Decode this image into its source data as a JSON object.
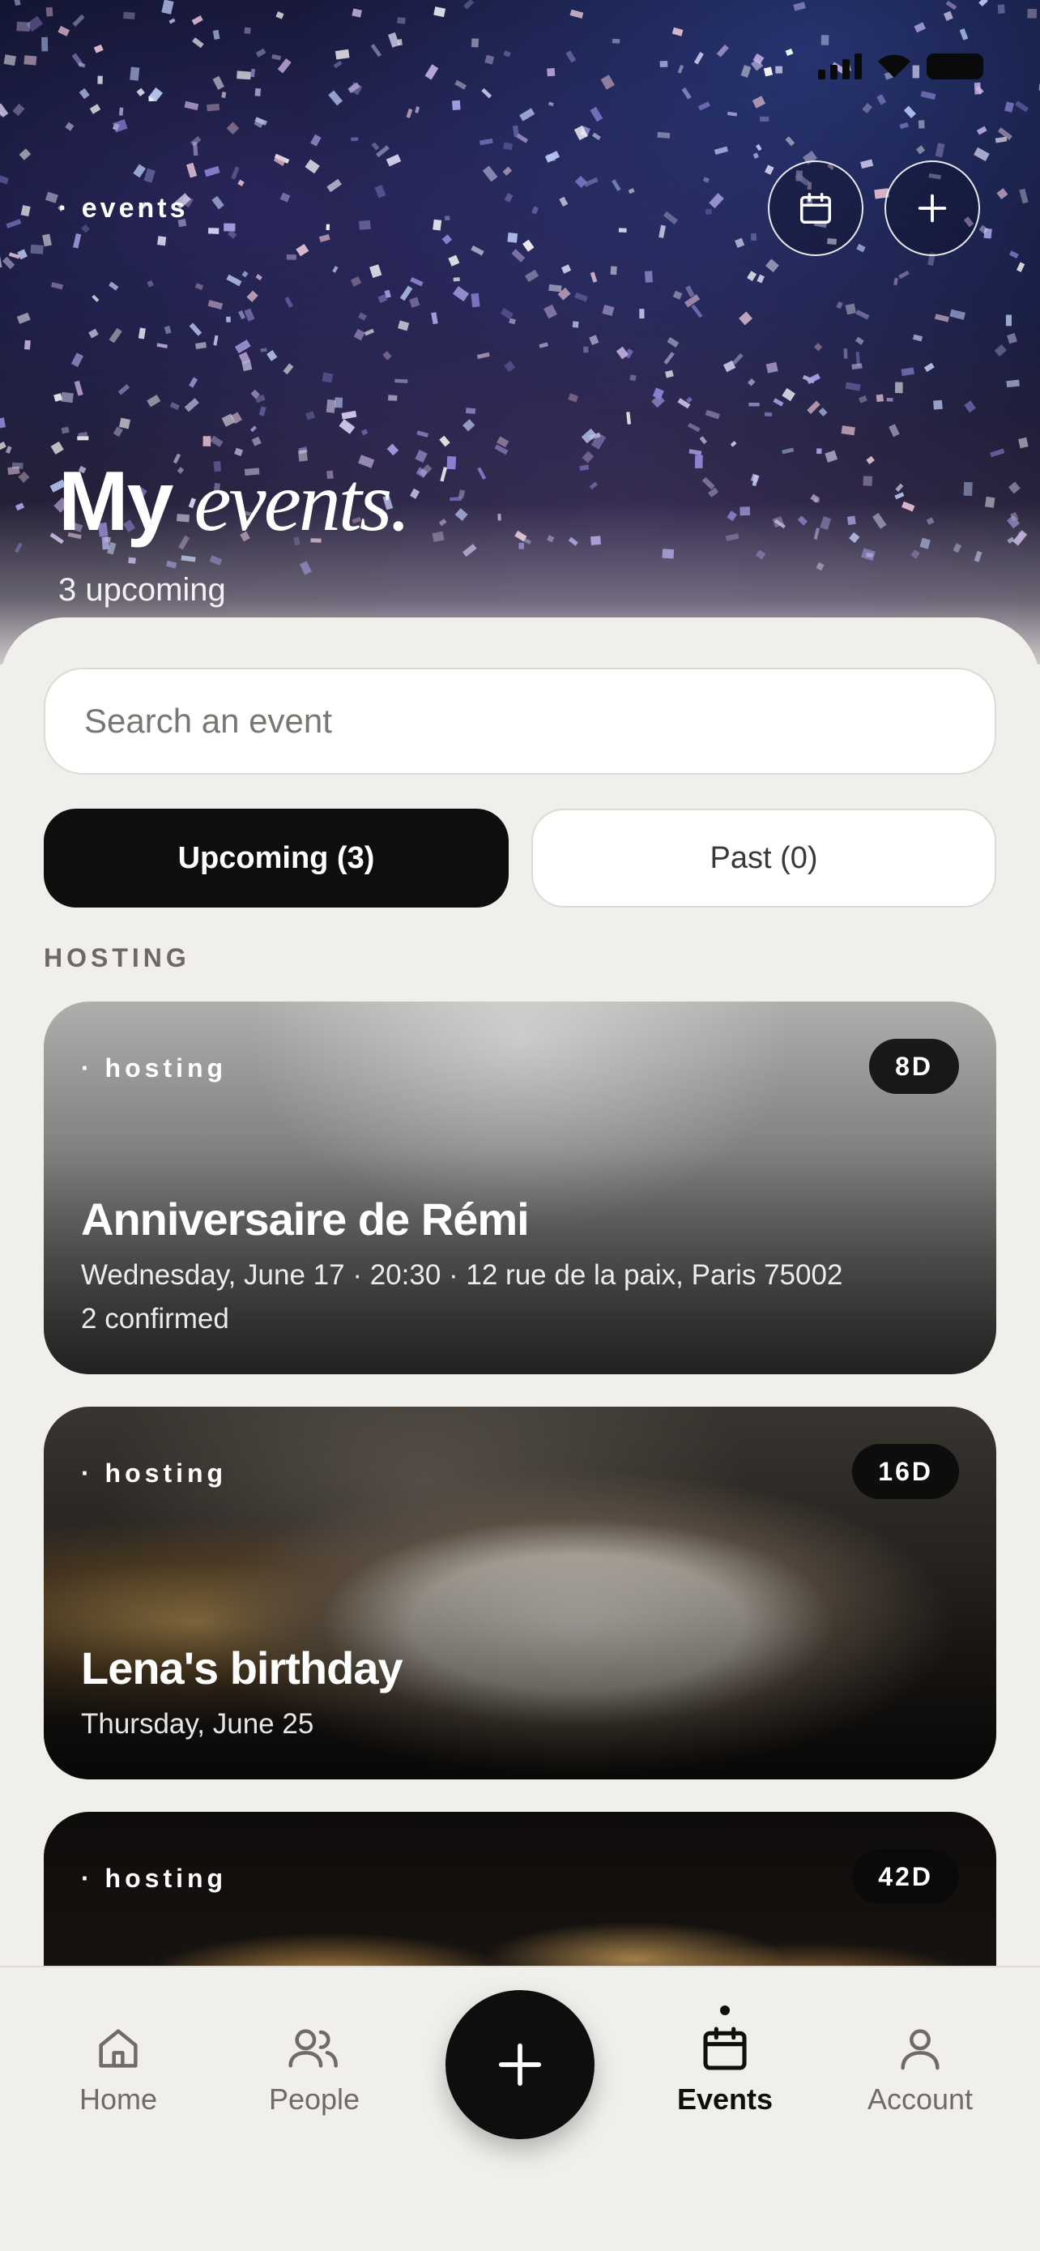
{
  "hero": {
    "label": "· events",
    "title_main": "My",
    "title_italic": "events.",
    "subtitle": "3 upcoming",
    "buttons": {
      "calendar_icon": "calendar-icon",
      "add_icon": "plus-icon"
    }
  },
  "search": {
    "placeholder": "Search an event",
    "value": ""
  },
  "tabs": [
    {
      "label": "Upcoming (3)",
      "active": true
    },
    {
      "label": "Past (0)",
      "active": false
    }
  ],
  "section": {
    "label": "HOSTING"
  },
  "events": [
    {
      "tag": "· hosting",
      "countdown": "8D",
      "title": "Anniversaire de Rémi",
      "details": "Wednesday, June 17 · 20:30 · 12 rue de la paix, Paris 75002",
      "confirmed": "2 confirmed"
    },
    {
      "tag": "· hosting",
      "countdown": "16D",
      "title": "Lena's birthday",
      "details": "Thursday, June 25"
    },
    {
      "tag": "· hosting",
      "countdown": "42D"
    }
  ],
  "nav": {
    "items": [
      {
        "label": "Home",
        "icon": "home-icon"
      },
      {
        "label": "People",
        "icon": "people-icon"
      },
      {
        "label": "Events",
        "icon": "calendar-icon",
        "active": true
      },
      {
        "label": "Account",
        "icon": "account-icon"
      }
    ],
    "fab_icon": "plus-icon"
  }
}
